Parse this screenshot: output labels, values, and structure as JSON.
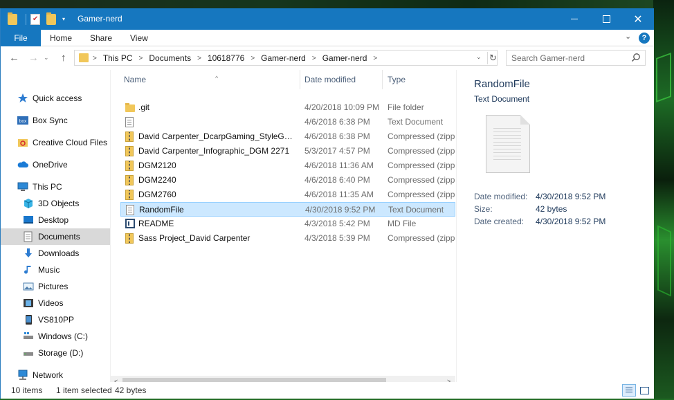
{
  "window": {
    "title": "Gamer-nerd"
  },
  "ribbon": {
    "file": "File",
    "tabs": [
      "Home",
      "Share",
      "View"
    ],
    "help": "?"
  },
  "address": {
    "crumbs": [
      "This PC",
      "Documents",
      "10618776",
      "Gamer-nerd",
      "Gamer-nerd"
    ],
    "search_placeholder": "Search Gamer-nerd"
  },
  "nav": {
    "items": [
      {
        "label": "Quick access",
        "icon": "star-icon"
      },
      {
        "label": "Box Sync",
        "icon": "box-icon"
      },
      {
        "label": "Creative Cloud Files",
        "icon": "creative-cloud-icon"
      },
      {
        "label": "OneDrive",
        "icon": "cloud-icon"
      },
      {
        "label": "This PC",
        "icon": "computer-icon"
      },
      {
        "label": "3D Objects",
        "icon": "cube-icon"
      },
      {
        "label": "Desktop",
        "icon": "desktop-icon"
      },
      {
        "label": "Documents",
        "icon": "documents-icon"
      },
      {
        "label": "Downloads",
        "icon": "download-arrow-icon"
      },
      {
        "label": "Music",
        "icon": "music-note-icon"
      },
      {
        "label": "Pictures",
        "icon": "pictures-icon"
      },
      {
        "label": "Videos",
        "icon": "film-icon"
      },
      {
        "label": "VS810PP",
        "icon": "phone-icon"
      },
      {
        "label": "Windows (C:)",
        "icon": "drive-icon"
      },
      {
        "label": "Storage (D:)",
        "icon": "drive-icon"
      },
      {
        "label": "Network",
        "icon": "network-icon"
      }
    ],
    "selected": "Documents"
  },
  "columns": {
    "name": "Name",
    "date": "Date modified",
    "type": "Type"
  },
  "files": [
    {
      "name": ".git",
      "date": "4/20/2018 10:09 PM",
      "type": "File folder",
      "icon": "folder-icon"
    },
    {
      "name": "",
      "date": "4/6/2018 6:38 PM",
      "type": "Text Document",
      "icon": "text-file-icon"
    },
    {
      "name": "David Carpenter_DcarpGaming_StyleGui...",
      "date": "4/6/2018 6:38 PM",
      "type": "Compressed (zipp...",
      "icon": "zip-icon"
    },
    {
      "name": "David Carpenter_Infographic_DGM 2271",
      "date": "5/3/2017 4:57 PM",
      "type": "Compressed (zipp...",
      "icon": "zip-icon"
    },
    {
      "name": "DGM2120",
      "date": "4/6/2018 11:36 AM",
      "type": "Compressed (zipp...",
      "icon": "zip-icon"
    },
    {
      "name": "DGM2240",
      "date": "4/6/2018 6:40 PM",
      "type": "Compressed (zipp...",
      "icon": "zip-icon"
    },
    {
      "name": "DGM2760",
      "date": "4/6/2018 11:35 AM",
      "type": "Compressed (zipp...",
      "icon": "zip-icon"
    },
    {
      "name": "RandomFile",
      "date": "4/30/2018 9:52 PM",
      "type": "Text Document",
      "icon": "text-file-icon",
      "selected": true
    },
    {
      "name": "README",
      "date": "4/3/2018 5:42 PM",
      "type": "MD File",
      "icon": "md-file-icon"
    },
    {
      "name": "Sass Project_David Carpenter",
      "date": "4/3/2018 5:39 PM",
      "type": "Compressed (zipp...",
      "icon": "zip-icon"
    }
  ],
  "details": {
    "title": "RandomFile",
    "type": "Text Document",
    "rows": [
      {
        "label": "Date modified:",
        "value": "4/30/2018 9:52 PM"
      },
      {
        "label": "Size:",
        "value": "42 bytes"
      },
      {
        "label": "Date created:",
        "value": "4/30/2018 9:52 PM"
      }
    ]
  },
  "status": {
    "items": "10 items",
    "selected": "1 item selected",
    "size": "42 bytes"
  },
  "colors": {
    "accent": "#1677bf",
    "selection": "#cce8ff"
  }
}
